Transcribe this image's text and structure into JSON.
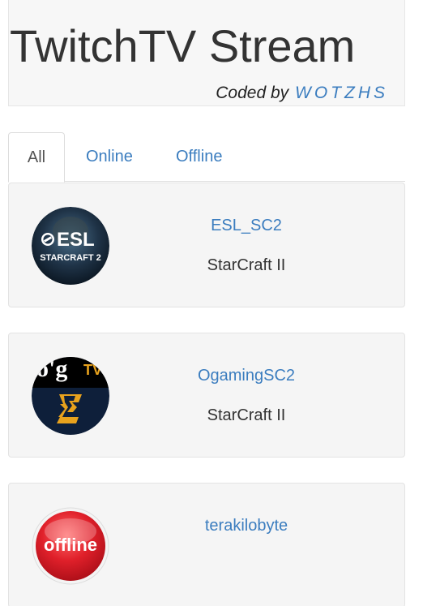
{
  "header": {
    "title": "TwitchTV Stream",
    "coded_by": "Coded by",
    "author": "WOTZHS"
  },
  "tabs": [
    {
      "label": "All",
      "active": true
    },
    {
      "label": "Online",
      "active": false
    },
    {
      "label": "Offline",
      "active": false
    }
  ],
  "streams": [
    {
      "name": "ESL_SC2",
      "game": "StarCraft II",
      "logo_text_1": "ESL",
      "logo_text_2": "STARCRAFT 2",
      "icon": "esl-logo-icon"
    },
    {
      "name": "OgamingSC2",
      "game": "StarCraft II",
      "logo_text_1": "o'g",
      "logo_text_2": "TV",
      "icon": "ogaming-logo-icon"
    },
    {
      "name": "terakilobyte",
      "game": "",
      "logo_text_1": "offline",
      "icon": "offline-badge-icon"
    }
  ],
  "colors": {
    "link": "#3b7dbf",
    "card_bg": "#f5f5f5",
    "offline_red": "#e0202a"
  }
}
